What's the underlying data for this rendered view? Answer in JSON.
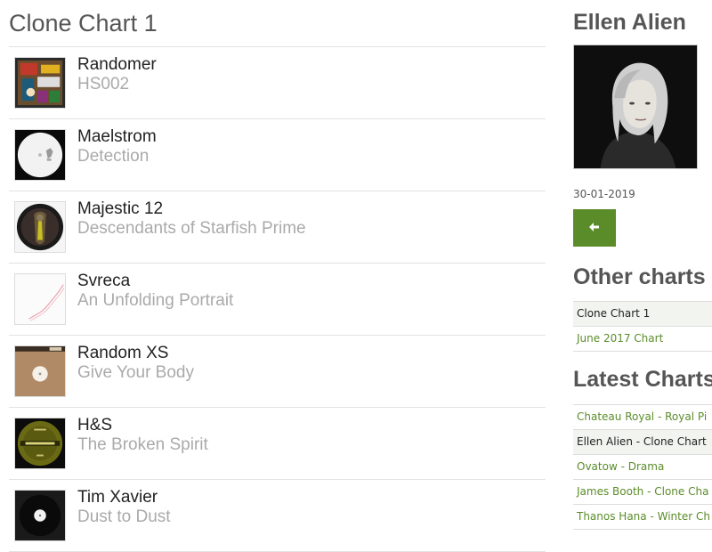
{
  "chart": {
    "title": "Clone Chart 1",
    "tracks": [
      {
        "artist": "Randomer",
        "title": "HS002"
      },
      {
        "artist": "Maelstrom",
        "title": "Detection"
      },
      {
        "artist": "Majestic 12",
        "title": "Descendants of Starfish Prime"
      },
      {
        "artist": "Svreca",
        "title": "An Unfolding Portrait"
      },
      {
        "artist": "Random XS",
        "title": "Give Your Body"
      },
      {
        "artist": "H&S",
        "title": "The Broken Spirit"
      },
      {
        "artist": "Tim Xavier",
        "title": "Dust to Dust"
      }
    ]
  },
  "sidebar": {
    "artist_name": "Ellen Alien",
    "date": "30-01-2019",
    "back_icon": "arrow-left-icon",
    "other_title": "Other charts b",
    "other_charts": [
      {
        "label": "Clone Chart 1",
        "active": true
      },
      {
        "label": "June 2017 Chart",
        "active": false
      }
    ],
    "latest_title": "Latest Charts",
    "latest_charts": [
      {
        "artist": "Chateau Royal",
        "sep": " - ",
        "chart": "Royal Pi"
      },
      {
        "artist": "Ellen Alien",
        "sep": " - ",
        "chart": "Clone Chart"
      },
      {
        "artist": "Ovatow",
        "sep": " - ",
        "chart": "Drama"
      },
      {
        "artist": "James Booth",
        "sep": " - ",
        "chart": "Clone Cha"
      },
      {
        "artist": "Thanos Hana",
        "sep": " - ",
        "chart": "Winter Ch"
      }
    ],
    "colors": {
      "accent": "#5b8c2a",
      "active_bg": "#f2f4ef"
    }
  }
}
